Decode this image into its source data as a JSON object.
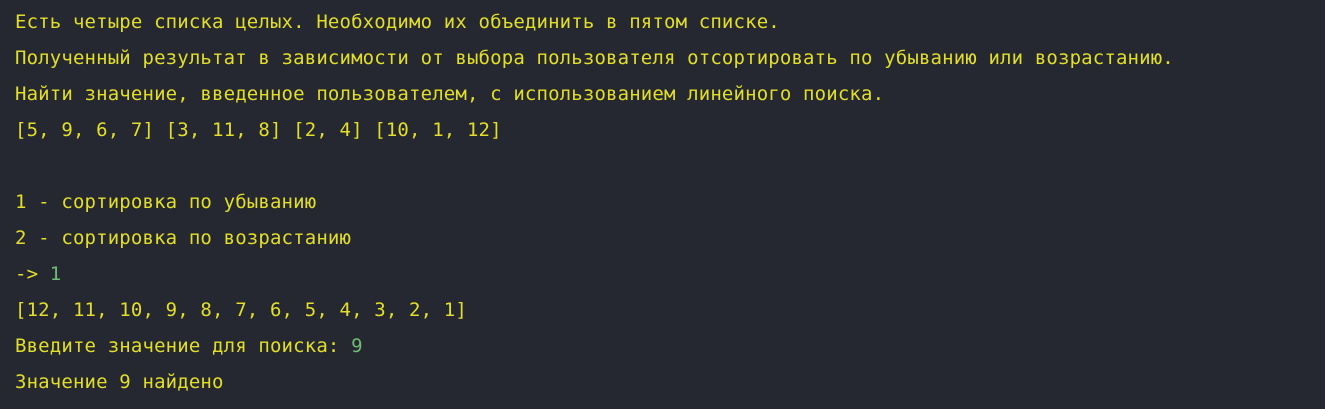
{
  "colors": {
    "background": "#252830",
    "output_text": "#e3df28",
    "user_input": "#6fbd72"
  },
  "console": {
    "task_line_1": "Есть четыре списка целых. Необходимо их объединить в пятом списке.",
    "task_line_2": "Полученный результат в зависимости от выбора пользователя отсортировать по убыванию или возрастанию.",
    "task_line_3": "Найти значение, введенное пользователем, с использованием линейного поиска.",
    "source_lists": "[5, 9, 6, 7] [3, 11, 8] [2, 4] [10, 1, 12]",
    "menu_option_1": "1 - сортировка по убыванию",
    "menu_option_2": "2 - сортировка по возрастанию",
    "choice_prompt": "-> ",
    "choice_input": "1",
    "sorted_result": "[12, 11, 10, 9, 8, 7, 6, 5, 4, 3, 2, 1]",
    "search_prompt": "Введите значение для поиска: ",
    "search_input": "9",
    "search_result": "Значение 9 найдено"
  }
}
